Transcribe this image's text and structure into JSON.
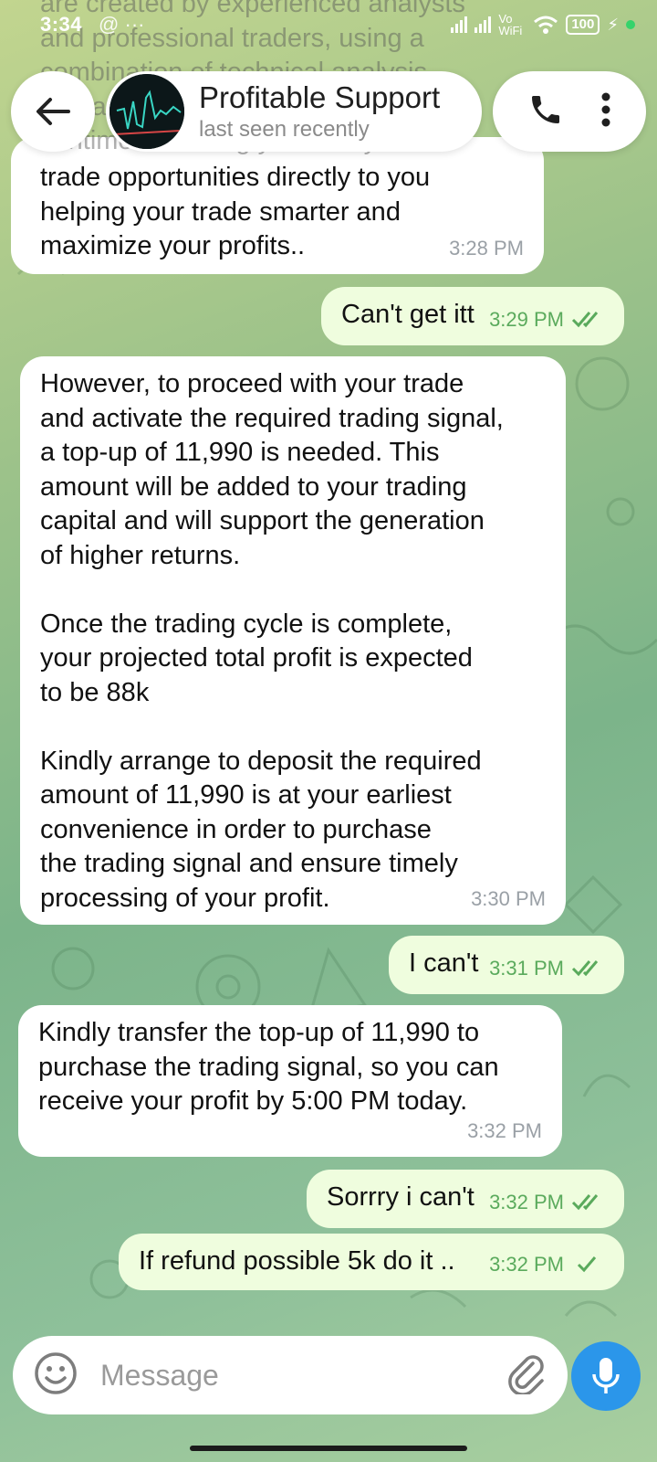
{
  "status_bar": {
    "time": "3:34",
    "extra": "@ ···",
    "network": "Vo WiFi",
    "battery": "100"
  },
  "header": {
    "contact_name": "Profitable Support",
    "status": "last seen recently",
    "icons": [
      "back-arrow-icon",
      "phone-icon",
      "more-vert-icon"
    ]
  },
  "partial_top_text": "are created by experienced analysts\nand professional traders, using a\ncombination of technical analysis,\nfundamental and sentiment analysis\nsentiment to bring you timely",
  "messages": [
    {
      "direction": "in",
      "text": "trade opportunities directly to you\nhelping your trade smarter and\nmaximize your profits..",
      "time": "3:28 PM"
    },
    {
      "direction": "out",
      "text": "Can't get itt",
      "time": "3:29 PM",
      "status": "read"
    },
    {
      "direction": "in",
      "text": "However, to proceed with your trade\nand activate the required trading signal,\na top-up of 11,990 is needed. This\namount will be added to your trading\ncapital and will support the generation\nof higher returns.\n\nOnce the trading cycle is complete,\nyour projected total profit is expected\nto be 88k\n\nKindly arrange to deposit the required\namount of 11,990 is at your earliest\nconvenience in order to purchase\nthe trading signal and ensure timely\nprocessing of your profit.",
      "time": "3:30 PM"
    },
    {
      "direction": "out",
      "text": "I can't",
      "time": "3:31 PM",
      "status": "read"
    },
    {
      "direction": "in",
      "text": "Kindly transfer the top-up of 11,990 to\npurchase the trading signal, so you can\nreceive your profit by 5:00 PM today.",
      "time": "3:32 PM"
    },
    {
      "direction": "out",
      "text": "Sorrry i can't",
      "time": "3:32 PM",
      "status": "read"
    },
    {
      "direction": "out",
      "text": "If refund possible 5k do it ..",
      "time": "3:32 PM",
      "status": "sent"
    }
  ],
  "composer": {
    "placeholder": "Message",
    "icons": [
      "emoji-icon",
      "attach-icon",
      "microphone-icon"
    ]
  },
  "colors": {
    "incoming_bubble": "#ffffff",
    "outgoing_bubble": "#effdde",
    "accent": "#2b96ea",
    "outgoing_meta": "#5aaa5c"
  }
}
